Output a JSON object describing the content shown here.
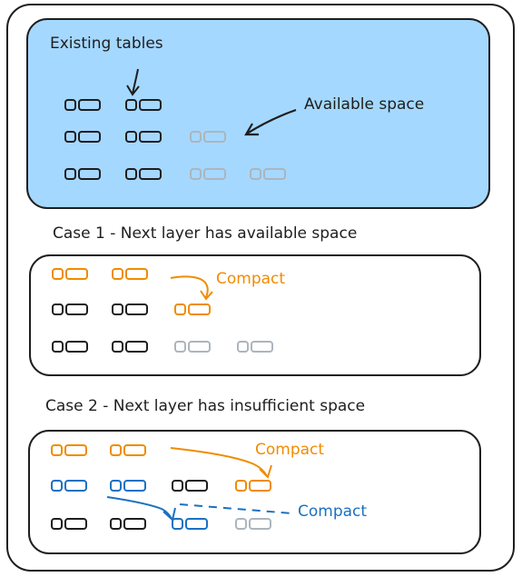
{
  "top_panel": {
    "fill": "#a5d8ff",
    "title": "Existing tables",
    "available_label": "Available space",
    "rows": [
      [
        "dark",
        "dark"
      ],
      [
        "dark",
        "dark",
        "gray"
      ],
      [
        "dark",
        "dark",
        "gray",
        "gray"
      ]
    ]
  },
  "case1": {
    "title": "Case 1 - Next layer has available space",
    "annotation": "Compact",
    "rows": [
      [
        "orange",
        "orange"
      ],
      [
        "dark",
        "dark",
        "orange"
      ],
      [
        "dark",
        "dark",
        "gray",
        "gray"
      ]
    ]
  },
  "case2": {
    "title": "Case 2 - Next layer has insufficient space",
    "annotation_top": "Compact",
    "annotation_bottom": "Compact",
    "rows": [
      [
        "orange",
        "orange"
      ],
      [
        "blue",
        "blue",
        "dark",
        "orange"
      ],
      [
        "dark",
        "dark",
        "blue",
        "gray"
      ]
    ]
  },
  "colors": {
    "dark": "#1e1e1e",
    "gray": "#adb5bd",
    "orange": "#f08c00",
    "blue": "#1971c2"
  }
}
